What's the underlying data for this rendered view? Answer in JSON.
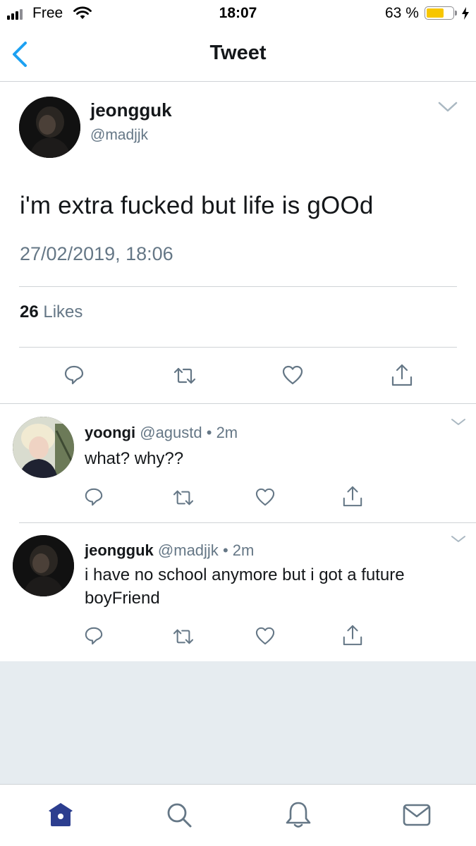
{
  "status_bar": {
    "carrier": "Free",
    "time": "18:07",
    "battery": "63 %",
    "battery_level": 0.63
  },
  "nav": {
    "title": "Tweet",
    "back_icon": "chevron-left-icon"
  },
  "tweet": {
    "name": "jeongguk",
    "handle": "@madjjk",
    "text": "i'm extra fucked but life is gOOd",
    "timestamp": "27/02/2019, 18:06",
    "likes_count": "26",
    "likes_label": "Likes"
  },
  "replies": [
    {
      "name": "yoongi",
      "handle": "@agustd",
      "time": "• 2m",
      "text": "what? why??"
    },
    {
      "name": "jeongguk",
      "handle": "@madjjk",
      "time": "• 2m",
      "text": "i have no school anymore but i got a future boyFriend"
    }
  ],
  "tab_bar": {
    "items": [
      "home-icon",
      "search-icon",
      "notifications-icon",
      "messages-icon"
    ]
  },
  "colors": {
    "accent": "#1da1f2",
    "text": "#14171a",
    "secondary": "#657786",
    "icon": "#657786",
    "tab_active": "#2c3e8f"
  }
}
